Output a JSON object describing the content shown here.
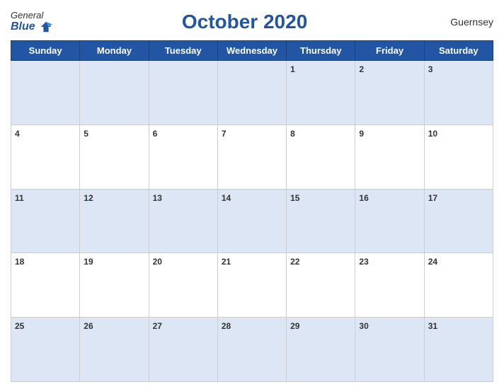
{
  "header": {
    "logo_general": "General",
    "logo_blue": "Blue",
    "title": "October 2020",
    "region": "Guernsey"
  },
  "calendar": {
    "days_of_week": [
      "Sunday",
      "Monday",
      "Tuesday",
      "Wednesday",
      "Thursday",
      "Friday",
      "Saturday"
    ],
    "weeks": [
      [
        "",
        "",
        "",
        "",
        "1",
        "2",
        "3"
      ],
      [
        "4",
        "5",
        "6",
        "7",
        "8",
        "9",
        "10"
      ],
      [
        "11",
        "12",
        "13",
        "14",
        "15",
        "16",
        "17"
      ],
      [
        "18",
        "19",
        "20",
        "21",
        "22",
        "23",
        "24"
      ],
      [
        "25",
        "26",
        "27",
        "28",
        "29",
        "30",
        "31"
      ]
    ]
  }
}
